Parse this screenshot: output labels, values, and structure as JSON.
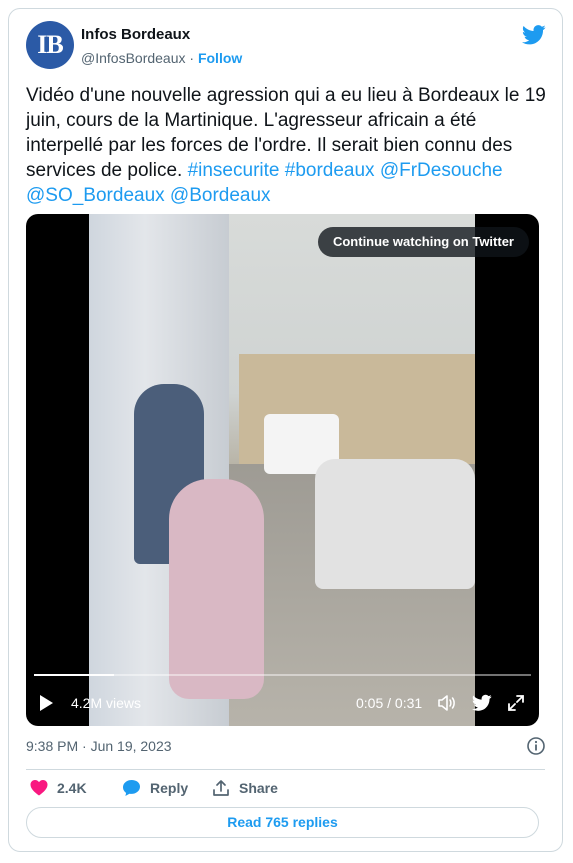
{
  "author": {
    "avatar_initials": "IB",
    "name": "Infos Bordeaux",
    "handle": "@InfosBordeaux",
    "separator": "·",
    "follow_label": "Follow"
  },
  "tweet": {
    "text_plain": "Vidéo d'une nouvelle agression qui a eu lieu à Bordeaux le 19 juin, cours de la Martinique. L'agresseur africain a été interpellé par les forces de l'ordre. Il serait bien connu des services de police.",
    "hashtag_1": "#insecurite",
    "hashtag_2": "#bordeaux",
    "mention_1": "@FrDesouche",
    "mention_2": "@SO_Bordeaux",
    "mention_3": "@Bordeaux"
  },
  "video": {
    "continue_label": "Continue watching on Twitter",
    "views": "4.2M views",
    "time": "0:05 / 0:31",
    "progress": 0.16
  },
  "meta": {
    "timestamp": "9:38 PM · Jun 19, 2023"
  },
  "actions": {
    "likes": "2.4K",
    "reply_label": "Reply",
    "share_label": "Share",
    "read_replies_label": "Read 765 replies"
  },
  "colors": {
    "accent": "#1d9bf0",
    "like": "#f91880",
    "text_secondary": "#536471",
    "avatar_bg": "#2b5aa6"
  },
  "icons": [
    "twitter-bird-icon",
    "play-icon",
    "volume-icon",
    "expand-icon",
    "info-icon",
    "heart-icon",
    "reply-bubble-icon",
    "share-upload-icon"
  ]
}
